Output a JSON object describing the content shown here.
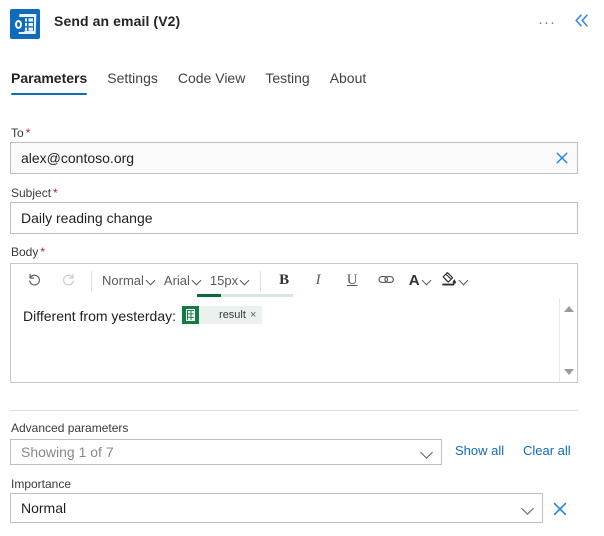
{
  "header": {
    "icon": "outlook-icon",
    "title": "Send an email (V2)",
    "more_label": "···",
    "collapse_label": "«"
  },
  "tabs": [
    {
      "label": "Parameters",
      "active": true
    },
    {
      "label": "Settings",
      "active": false
    },
    {
      "label": "Code View",
      "active": false
    },
    {
      "label": "Testing",
      "active": false
    },
    {
      "label": "About",
      "active": false
    }
  ],
  "fields": {
    "to": {
      "label": "To",
      "required": "*",
      "value": "alex@contoso.org",
      "clear_icon": "close-icon"
    },
    "subject": {
      "label": "Subject",
      "required": "*",
      "value": "Daily reading change"
    },
    "body": {
      "label": "Body",
      "required": "*",
      "text": "Different from yesterday:",
      "token": {
        "icon": "excel-icon",
        "label": "result",
        "remove_label": "×"
      }
    }
  },
  "toolbar": {
    "undo": "undo-icon",
    "redo": "redo-icon",
    "style": "Normal",
    "font": "Arial",
    "size": "15px",
    "bold": "B",
    "italic": "I",
    "underline": "U",
    "link": "link-icon",
    "font_color": "A",
    "highlight": "highlight-icon"
  },
  "advanced": {
    "label": "Advanced parameters",
    "dropdown_value": "Showing 1 of 7",
    "show_all": "Show all",
    "clear_all": "Clear all"
  },
  "importance": {
    "label": "Importance",
    "value": "Normal",
    "clear_icon": "close-icon"
  },
  "colors": {
    "accent": "#0f6cbd",
    "link": "#0f6cbd",
    "required": "#a4262c",
    "excel_green": "#107c41",
    "progress_green": "#0b6a3a"
  }
}
